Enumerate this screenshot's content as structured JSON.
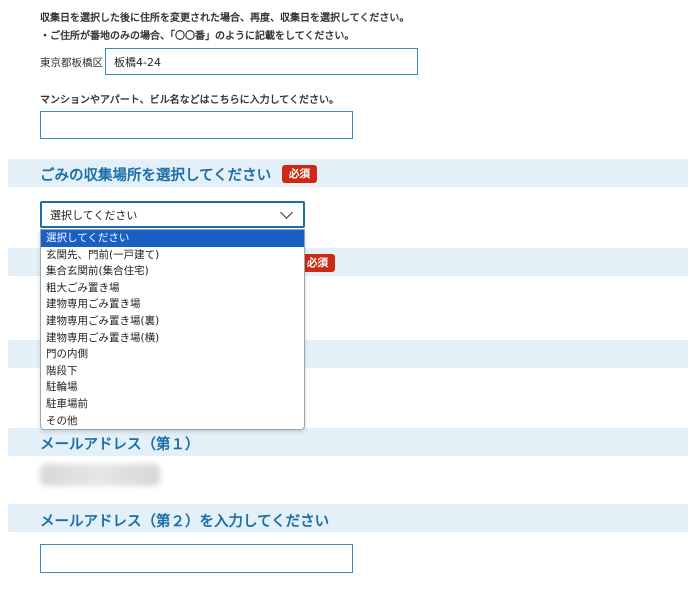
{
  "notes": [
    "収集日を選択した後に住所を変更された場合、再度、収集日を選択してください。",
    "・ご住所が番地のみの場合、「〇〇番」のように記載をしてください。"
  ],
  "address": {
    "prefix": "東京都板橋区",
    "value": "板橋4-24"
  },
  "building": {
    "label": "マンションやアパート、ビル名などはこちらに入力してください。",
    "value": ""
  },
  "collection_place": {
    "title": "ごみの収集場所を選択してください",
    "required_badge": "必須",
    "selected": "選択してください",
    "options": [
      "選択してください",
      "玄関先、門前(一戸建て)",
      "集合玄関前(集合住宅)",
      "粗大ごみ置き場",
      "建物専用ごみ置き場",
      "建物専用ごみ置き場(裏)",
      "建物専用ごみ置き場(横)",
      "門の内側",
      "階段下",
      "駐輪場",
      "駐車場前",
      "その他"
    ]
  },
  "hidden_section": {
    "required_badge": "必須"
  },
  "email1": {
    "title": "メールアドレス（第１）"
  },
  "email2": {
    "title": "メールアドレス（第２）を入力してください",
    "value": ""
  },
  "colors": {
    "accent": "#1a6fa8",
    "band": "#e4f0f8",
    "required": "#cc2a14",
    "selected_option": "#1a5fc6"
  }
}
